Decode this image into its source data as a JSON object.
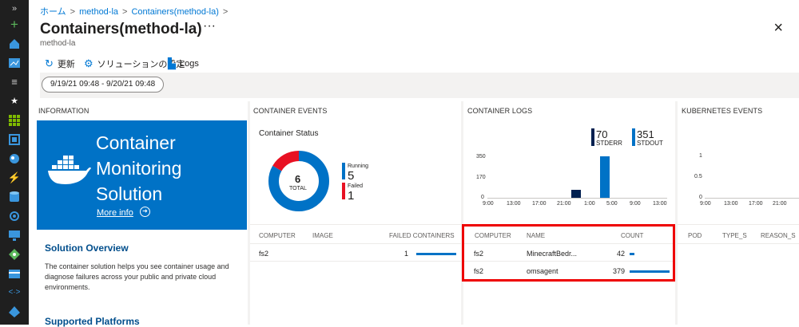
{
  "breadcrumb": {
    "home": "ホーム",
    "item1": "method-la",
    "item2": "Containers(method-la)",
    "separator": ">"
  },
  "title": "Containers(method-la)",
  "ellipsis": "···",
  "subtitle": "method-la",
  "close_icon": "×",
  "toolbar": {
    "refresh": "更新",
    "settings": "ソリューションの設定",
    "logs": "Logs"
  },
  "time_range": "9/19/21 09:48 - 9/20/21 09:48",
  "sections": {
    "information": "INFORMATION",
    "container_events": "CONTAINER EVENTS",
    "container_logs": "CONTAINER LOGS",
    "kubernetes_events": "KUBERNETES EVENTS"
  },
  "info_tile": {
    "line1": "Container",
    "line2": "Monitoring",
    "line3": "Solution",
    "more_info": "More info",
    "color": "#0072c6"
  },
  "overview": {
    "title": "Solution Overview",
    "text": "The container solution helps you see container usage and diagnose failures across your public and private cloud environments."
  },
  "supported_platforms": "Supported Platforms",
  "container_status": {
    "title": "Container Status",
    "total": "6",
    "total_label": "TOTAL",
    "running_label": "Running",
    "running_value": "5",
    "failed_label": "Failed",
    "failed_value": "1",
    "running_color": "#0072c6",
    "failed_color": "#e81123"
  },
  "logs_chart": {
    "stderr_value": "70",
    "stderr_label": "STDERR",
    "stdout_value": "351",
    "stdout_label": "STDOUT",
    "y_ticks": [
      "350",
      "170",
      "0"
    ],
    "x_ticks": [
      "9:00",
      "13:00",
      "17:00",
      "21:00",
      "1:00",
      "5:00",
      "9:00",
      "13:00"
    ],
    "stderr_color": "#002050",
    "stdout_color": "#0072c6"
  },
  "kube_chart": {
    "y_ticks": [
      "1",
      "0.5",
      "0"
    ],
    "x_ticks": [
      "9:00",
      "13:00",
      "17:00",
      "21:00"
    ]
  },
  "events_table": {
    "headers": [
      "COMPUTER",
      "IMAGE",
      "FAILED CONTAINERS"
    ],
    "rows": [
      {
        "computer": "fs2",
        "image": "",
        "failed": "1",
        "fraction": 1.0
      }
    ]
  },
  "logs_table": {
    "headers": [
      "COMPUTER",
      "NAME",
      "COUNT"
    ],
    "rows": [
      {
        "computer": "fs2",
        "name": "MinecraftBedr...",
        "count": "42",
        "fraction": 0.11
      },
      {
        "computer": "fs2",
        "name": "omsagent",
        "count": "379",
        "fraction": 1.0
      }
    ]
  },
  "kube_table": {
    "headers": [
      "POD",
      "TYPE_S",
      "REASON_S"
    ]
  },
  "chart_data": [
    {
      "type": "pie",
      "title": "Container Status",
      "categories": [
        "Running",
        "Failed"
      ],
      "values": [
        5,
        1
      ]
    },
    {
      "type": "bar",
      "categories": [
        "9:00",
        "13:00",
        "17:00",
        "21:00",
        "1:00",
        "5:00",
        "9:00",
        "13:00"
      ],
      "series": [
        {
          "name": "STDERR",
          "values": [
            0,
            0,
            0,
            0,
            0,
            70,
            0,
            0
          ]
        },
        {
          "name": "STDOUT",
          "values": [
            0,
            0,
            0,
            0,
            0,
            0,
            351,
            0
          ]
        }
      ],
      "ylim": [
        0,
        350
      ]
    }
  ]
}
